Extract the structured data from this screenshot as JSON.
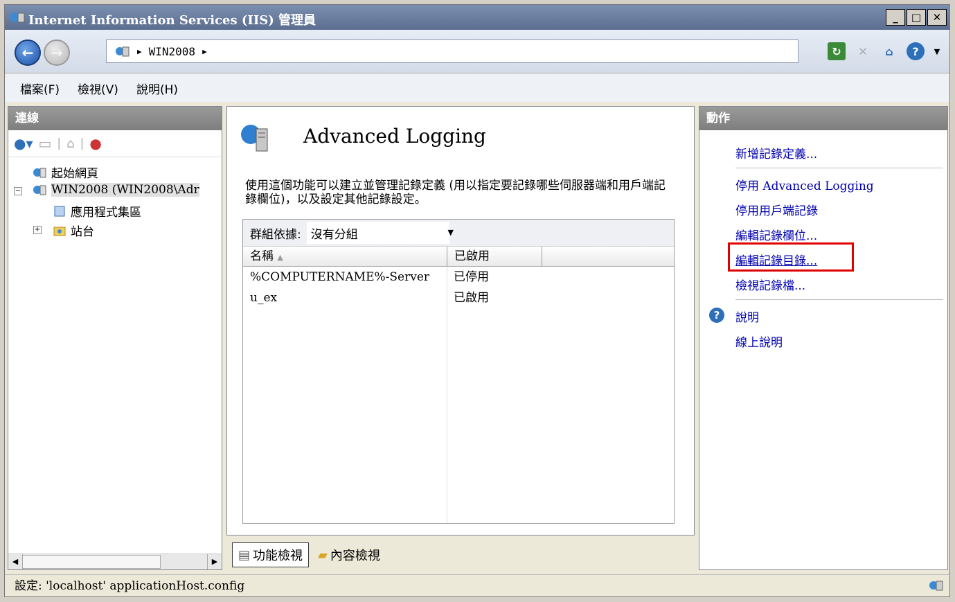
{
  "window": {
    "title": "Internet Information Services (IIS) 管理員"
  },
  "address": {
    "path": [
      "WIN2008"
    ]
  },
  "menu": {
    "items": [
      "檔案(F)",
      "檢視(V)",
      "說明(H)"
    ]
  },
  "connections": {
    "header": "連線",
    "tree": [
      {
        "label": "起始網頁"
      },
      {
        "label": "WIN2008 (WIN2008\\Adr"
      },
      {
        "label": "應用程式集區"
      },
      {
        "label": "站台"
      }
    ]
  },
  "main": {
    "title": "Advanced Logging",
    "description": "使用這個功能可以建立並管理記錄定義 (用以指定要記錄哪些伺服器端和用戶端記錄欄位)，以及設定其他記錄設定。",
    "group_label": "群組依據:",
    "group_value": "沒有分組",
    "columns": [
      "名稱",
      "已啟用"
    ],
    "rows": [
      {
        "name": "%COMPUTERNAME%-Server",
        "enabled": "已停用"
      },
      {
        "name": "u_ex",
        "enabled": "已啟用"
      }
    ],
    "view_tabs": [
      "功能檢視",
      "內容檢視"
    ]
  },
  "actions": {
    "header": "動作",
    "items": [
      "新增記錄定義...",
      "停用 Advanced Logging",
      "停用用戶端記錄",
      "編輯記錄欄位...",
      "編輯記錄目錄...",
      "檢視記錄檔..."
    ],
    "help": "說明",
    "online_help": "線上說明"
  },
  "status": {
    "text": "設定: 'localhost' applicationHost.config"
  },
  "colors": {
    "highlight": "#e00000",
    "link": "#0000b0"
  }
}
